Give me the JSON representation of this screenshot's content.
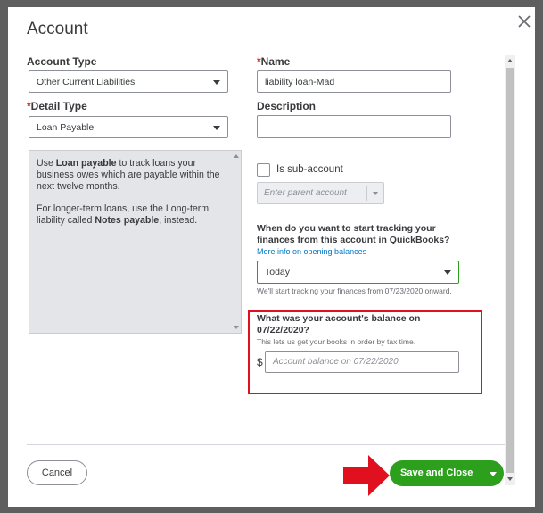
{
  "dialog": {
    "title": "Account",
    "close_icon": "close-icon"
  },
  "left": {
    "account_type_label": "Account Type",
    "account_type_value": "Other Current Liabilities",
    "detail_type_required": "*",
    "detail_type_label": "Detail Type",
    "detail_type_value": "Loan Payable",
    "info": {
      "p1_before": "Use ",
      "p1_bold": "Loan payable",
      "p1_after": " to track loans your business owes which are payable within the next twelve months.",
      "p2_before": "For longer-term loans, use the Long-term liability called ",
      "p2_bold": "Notes payable",
      "p2_after": ", instead."
    }
  },
  "right": {
    "name_required": "*",
    "name_label": "Name",
    "name_value": "liability loan-Mad",
    "description_label": "Description",
    "description_value": "",
    "subaccount_label": "Is sub-account",
    "parent_placeholder": "Enter parent account",
    "tracking_question": "When do you want to start tracking your finances from this account in QuickBooks?",
    "opening_balances_link": "More info on opening balances",
    "tracking_value": "Today",
    "tracking_note": "We'll start tracking your finances from 07/23/2020 onward.",
    "balance_question": "What was your account's balance on 07/22/2020?",
    "balance_note": "This lets us get your books in order by tax time.",
    "currency_symbol": "$",
    "balance_placeholder": "Account balance on 07/22/2020"
  },
  "footer": {
    "cancel_label": "Cancel",
    "save_label": "Save and Close"
  },
  "colors": {
    "primary_green": "#2ca01c",
    "link_blue": "#0077c5",
    "required_red": "#d52b1e",
    "annotation_red": "#e0101e"
  }
}
